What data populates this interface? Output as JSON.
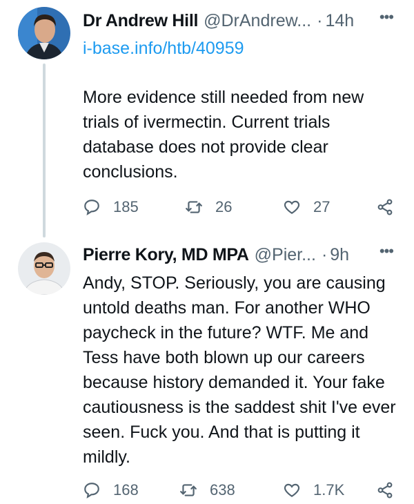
{
  "tweet1": {
    "name": "Dr Andrew Hill",
    "handle": "@DrAndrew...",
    "separator": "·",
    "time": "14h",
    "more": "•••",
    "link": "i-base.info/htb/40959",
    "text": "More evidence still needed from new trials of ivermectin.   Current  trials database does not provide clear conclusions.",
    "replies": "185",
    "retweets": "26",
    "likes": "27"
  },
  "tweet2": {
    "name": "Pierre Kory, MD MPA",
    "handle": "@Pier...",
    "separator": "·",
    "time": "9h",
    "more": "•••",
    "text": "Andy, STOP. Seriously, you are causing untold deaths man. For another WHO paycheck in the future? WTF. Me and Tess have both blown up our careers because history demanded it. Your fake cautiousness is the saddest shit I've ever seen. Fuck you. And that is putting it mildly.",
    "replies": "168",
    "retweets": "638",
    "likes": "1.7K"
  },
  "icons": [
    "reply-icon",
    "retweet-icon",
    "like-icon",
    "share-icon",
    "more-icon"
  ],
  "colors": {
    "link": "#1d9bf0",
    "muted": "#536471",
    "text": "#0f1419",
    "thread_line": "#cfd9de"
  }
}
